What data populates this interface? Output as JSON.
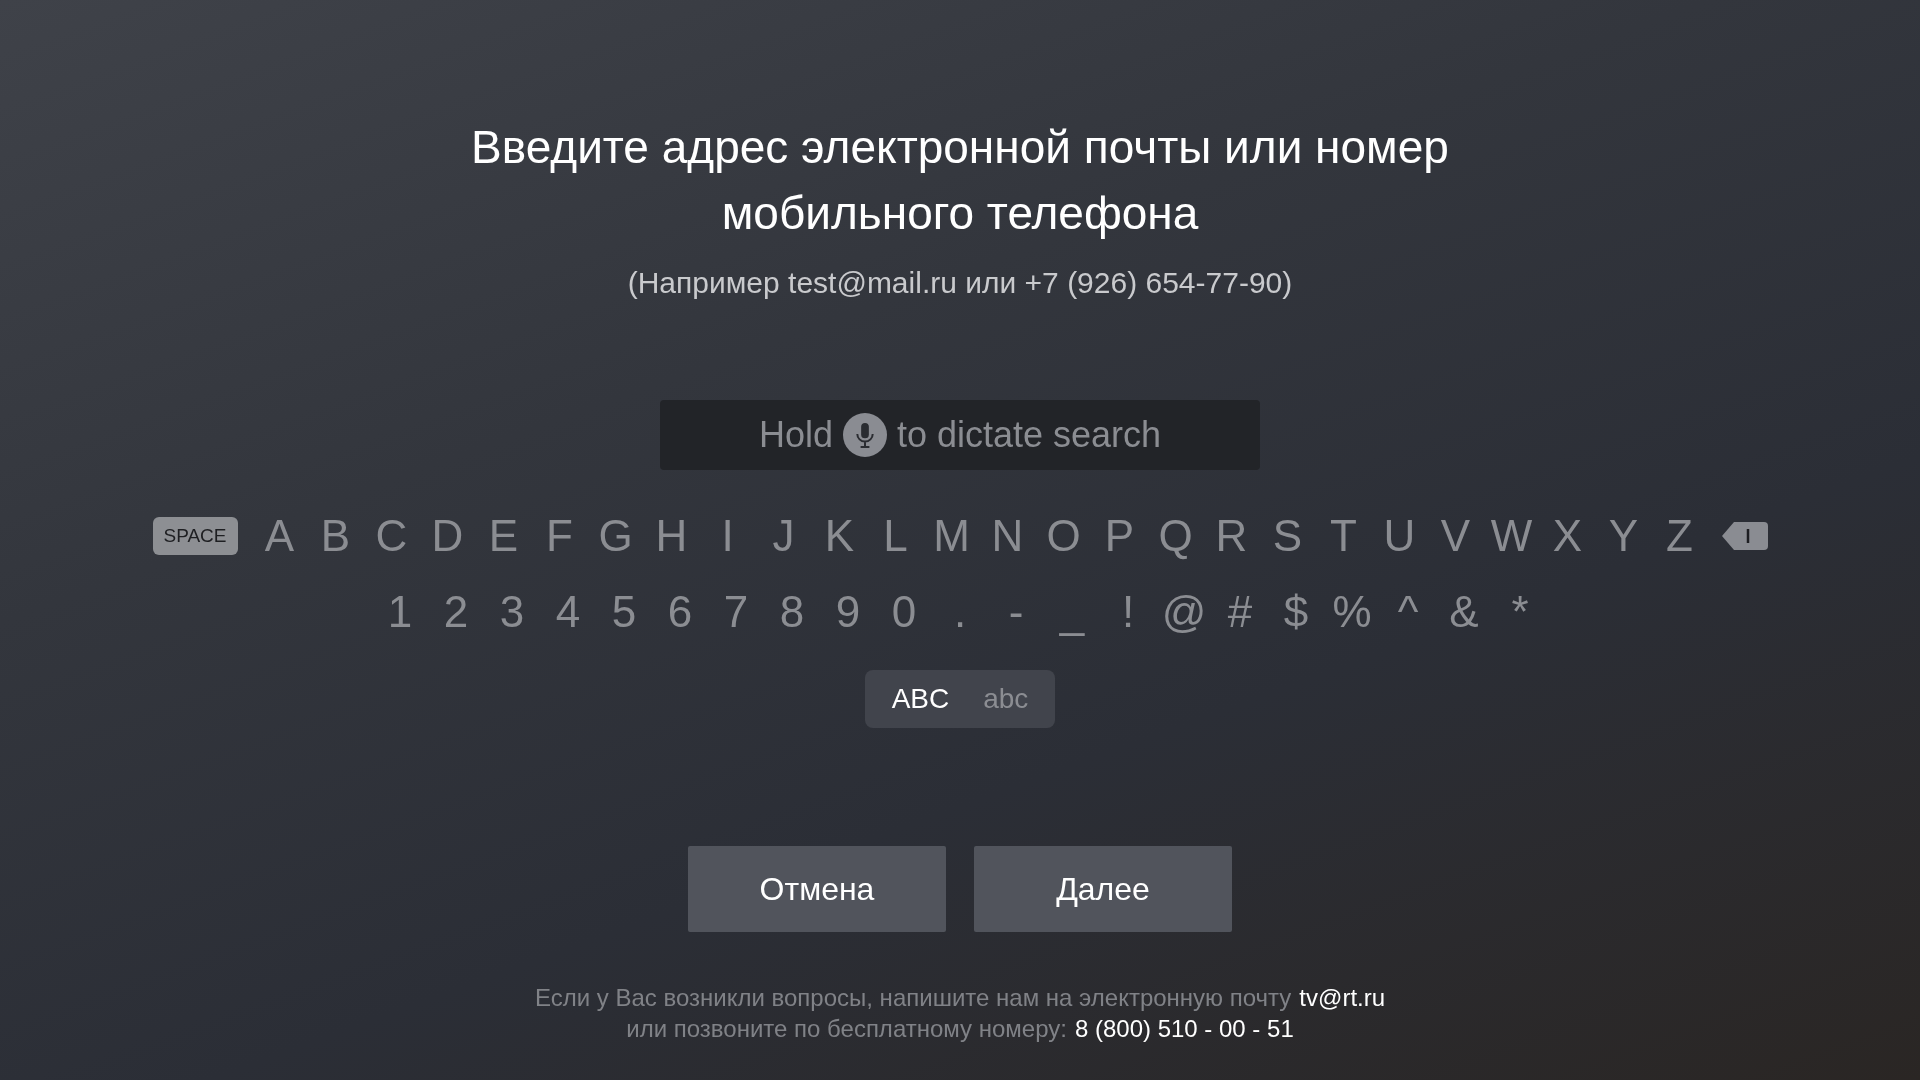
{
  "title": "Введите адрес электронной почты или номер мобильного телефона",
  "hint": "(Например test@mail.ru или +7 (926) 654-77-90)",
  "search": {
    "placeholder_before": "Hold",
    "placeholder_after": "to dictate search"
  },
  "keyboard": {
    "letter_keys": [
      {
        "kind": "space",
        "label": "SPACE"
      },
      {
        "kind": "char",
        "label": "A"
      },
      {
        "kind": "char",
        "label": "B"
      },
      {
        "kind": "char",
        "label": "C"
      },
      {
        "kind": "char",
        "label": "D"
      },
      {
        "kind": "char",
        "label": "E"
      },
      {
        "kind": "char",
        "label": "F"
      },
      {
        "kind": "char",
        "label": "G"
      },
      {
        "kind": "char",
        "label": "H"
      },
      {
        "kind": "char",
        "label": "I"
      },
      {
        "kind": "char",
        "label": "J"
      },
      {
        "kind": "char",
        "label": "K"
      },
      {
        "kind": "char",
        "label": "L"
      },
      {
        "kind": "char",
        "label": "M"
      },
      {
        "kind": "char",
        "label": "N"
      },
      {
        "kind": "char",
        "label": "O"
      },
      {
        "kind": "char",
        "label": "P"
      },
      {
        "kind": "char",
        "label": "Q"
      },
      {
        "kind": "char",
        "label": "R"
      },
      {
        "kind": "char",
        "label": "S"
      },
      {
        "kind": "char",
        "label": "T"
      },
      {
        "kind": "char",
        "label": "U"
      },
      {
        "kind": "char",
        "label": "V"
      },
      {
        "kind": "char",
        "label": "W"
      },
      {
        "kind": "char",
        "label": "X"
      },
      {
        "kind": "char",
        "label": "Y"
      },
      {
        "kind": "char",
        "label": "Z"
      },
      {
        "kind": "delete"
      }
    ],
    "symbol_keys": [
      {
        "kind": "char",
        "label": "1"
      },
      {
        "kind": "char",
        "label": "2"
      },
      {
        "kind": "char",
        "label": "3"
      },
      {
        "kind": "char",
        "label": "4"
      },
      {
        "kind": "char",
        "label": "5"
      },
      {
        "kind": "char",
        "label": "6"
      },
      {
        "kind": "char",
        "label": "7"
      },
      {
        "kind": "char",
        "label": "8"
      },
      {
        "kind": "char",
        "label": "9"
      },
      {
        "kind": "char",
        "label": "0"
      },
      {
        "kind": "char",
        "label": "."
      },
      {
        "kind": "char",
        "label": "-"
      },
      {
        "kind": "char",
        "label": "_"
      },
      {
        "kind": "char",
        "label": "!"
      },
      {
        "kind": "char",
        "label": "@"
      },
      {
        "kind": "char",
        "label": "#"
      },
      {
        "kind": "char",
        "label": "$"
      },
      {
        "kind": "char",
        "label": "%"
      },
      {
        "kind": "char",
        "label": "^"
      },
      {
        "kind": "char",
        "label": "&"
      },
      {
        "kind": "char",
        "label": "*"
      }
    ],
    "case_toggle": [
      {
        "label": "ABC",
        "selected": true
      },
      {
        "label": "abc",
        "selected": false
      }
    ]
  },
  "buttons": [
    {
      "label": "Отмена"
    },
    {
      "label": "Далее"
    }
  ],
  "footer": [
    {
      "text": "Если у Вас возникли вопросы, напишите нам на электронную почту",
      "contact": "tv@rt.ru"
    },
    {
      "text": "или позвоните по бесплатному номеру:",
      "contact": "8 (800) 510 - 00 - 51"
    }
  ]
}
